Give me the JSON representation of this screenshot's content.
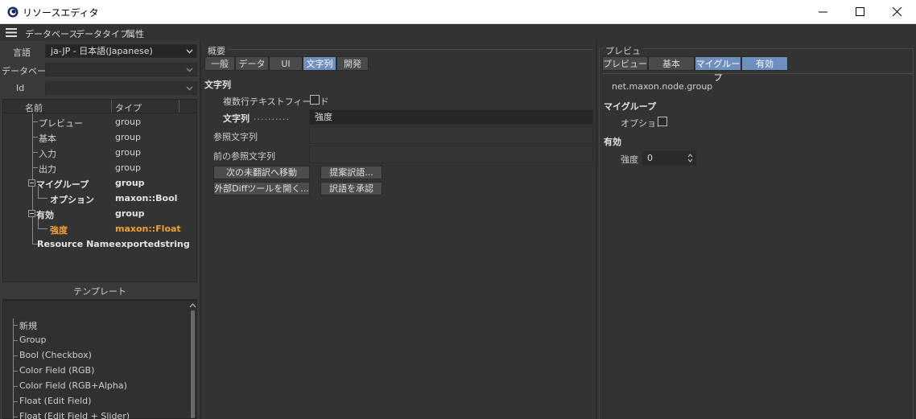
{
  "window": {
    "title": "リソースエディタ"
  },
  "menu": [
    "データベース",
    "データタイプ",
    "属性"
  ],
  "left": {
    "language_label": "言語",
    "language_value": "ja-JP - 日本語(Japanese)",
    "database_label": "データベース",
    "database_value": "",
    "id_label": "Id",
    "id_value": "",
    "tree_columns": {
      "name": "名前",
      "type": "タイプ"
    },
    "tree_rows": [
      {
        "name": "プレビュー",
        "type": "group"
      },
      {
        "name": "基本",
        "type": "group"
      },
      {
        "name": "入力",
        "type": "group"
      },
      {
        "name": "出力",
        "type": "group"
      },
      {
        "name": "マイグループ",
        "type": "group"
      },
      {
        "name": "オプション",
        "type": "maxon::Bool"
      },
      {
        "name": "有効",
        "type": "group"
      },
      {
        "name": "強度",
        "type": "maxon::Float"
      },
      {
        "name": "Resource Name",
        "type": "exportedstring"
      }
    ],
    "template_title": "テンプレート",
    "templates": [
      "新規",
      "Group",
      "Bool (Checkbox)",
      "Color Field (RGB)",
      "Color Field (RGB+Alpha)",
      "Float (Edit Field)",
      "Float (Edit Field + Slider)"
    ]
  },
  "middle": {
    "caption": "概要",
    "tabs": [
      "一般",
      "データ",
      "UI",
      "文字列",
      "開発"
    ],
    "active_tab": "文字列",
    "section_title": "文字列",
    "multiline_label": "複数行テキストフィールド",
    "string_label": "文字列",
    "string_dots": "..........",
    "string_value": "強度",
    "ref_label": "参照文字列",
    "prev_ref_label": "前の参照文字列",
    "btn_next_untranslated": "次の未翻訳へ移動",
    "btn_suggest": "提案訳語...",
    "btn_diff": "外部Diffツールを開く...",
    "btn_approve": "訳語を承認"
  },
  "right": {
    "caption": "プレビュ",
    "tabs": [
      "プレビュー",
      "基本",
      "マイグループ",
      "有効"
    ],
    "active_tabs": [
      "マイグループ",
      "有効"
    ],
    "group_id": "net.maxon.node.group",
    "mygroup_title": "マイグループ",
    "option_label": "オプション",
    "enabled_title": "有効",
    "strength_label": "強度",
    "strength_value": "0"
  }
}
